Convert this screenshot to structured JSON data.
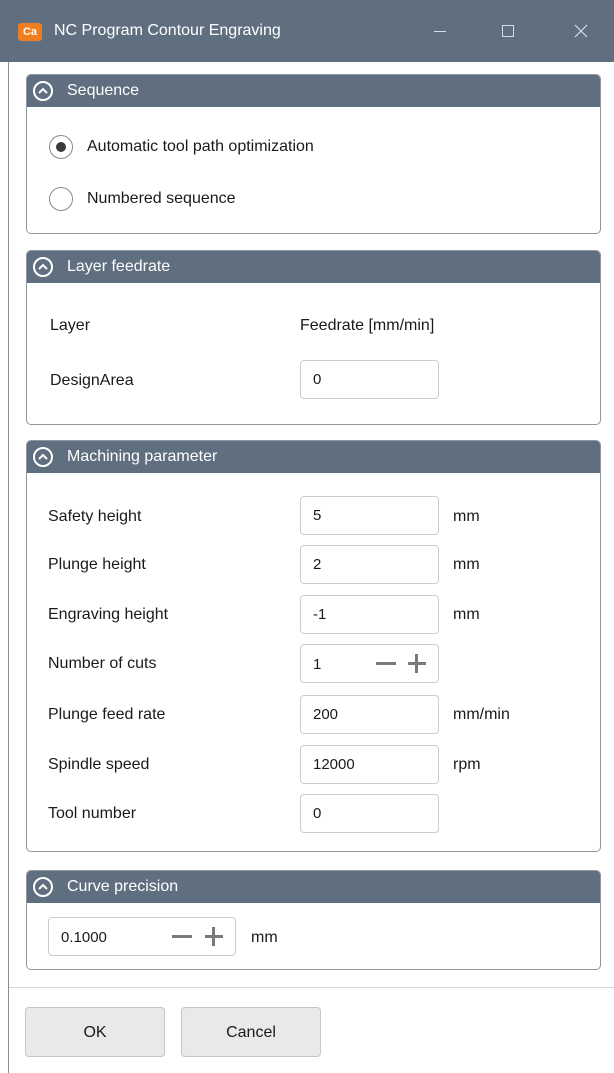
{
  "window": {
    "app_icon_text": "Ca",
    "title": "NC Program Contour Engraving",
    "minimize_glyph": "—",
    "maximize_glyph": "☐",
    "close_glyph": "✕"
  },
  "sequence": {
    "title": "Sequence",
    "options": [
      {
        "label": "Automatic tool path optimization",
        "checked": true
      },
      {
        "label": "Numbered sequence",
        "checked": false
      }
    ]
  },
  "layer_feedrate": {
    "title": "Layer feedrate",
    "col_layer": "Layer",
    "col_feedrate": "Feedrate [mm/min]",
    "rows": [
      {
        "layer": "DesignArea",
        "feedrate": "0"
      }
    ]
  },
  "machining": {
    "title": "Machining parameter",
    "safety_height": {
      "label": "Safety height",
      "value": "5",
      "unit": "mm"
    },
    "plunge_height": {
      "label": "Plunge height",
      "value": "2",
      "unit": "mm"
    },
    "engraving_height": {
      "label": "Engraving height",
      "value": "-1",
      "unit": "mm"
    },
    "number_of_cuts": {
      "label": "Number of cuts",
      "value": "1"
    },
    "plunge_feed_rate": {
      "label": "Plunge feed rate",
      "value": "200",
      "unit": "mm/min"
    },
    "spindle_speed": {
      "label": "Spindle speed",
      "value": "12000",
      "unit": "rpm"
    },
    "tool_number": {
      "label": "Tool number",
      "value": "0"
    }
  },
  "curve_precision": {
    "title": "Curve precision",
    "value": "0.1000",
    "unit": "mm"
  },
  "buttons": {
    "ok": "OK",
    "cancel": "Cancel"
  },
  "colors": {
    "header": "#5f6f7f",
    "app_icon": "#f07e1e"
  },
  "icons": {
    "panel_toggle": "chevron-up-circle-icon",
    "stepper_minus": "minus-icon",
    "stepper_plus": "plus-icon"
  }
}
